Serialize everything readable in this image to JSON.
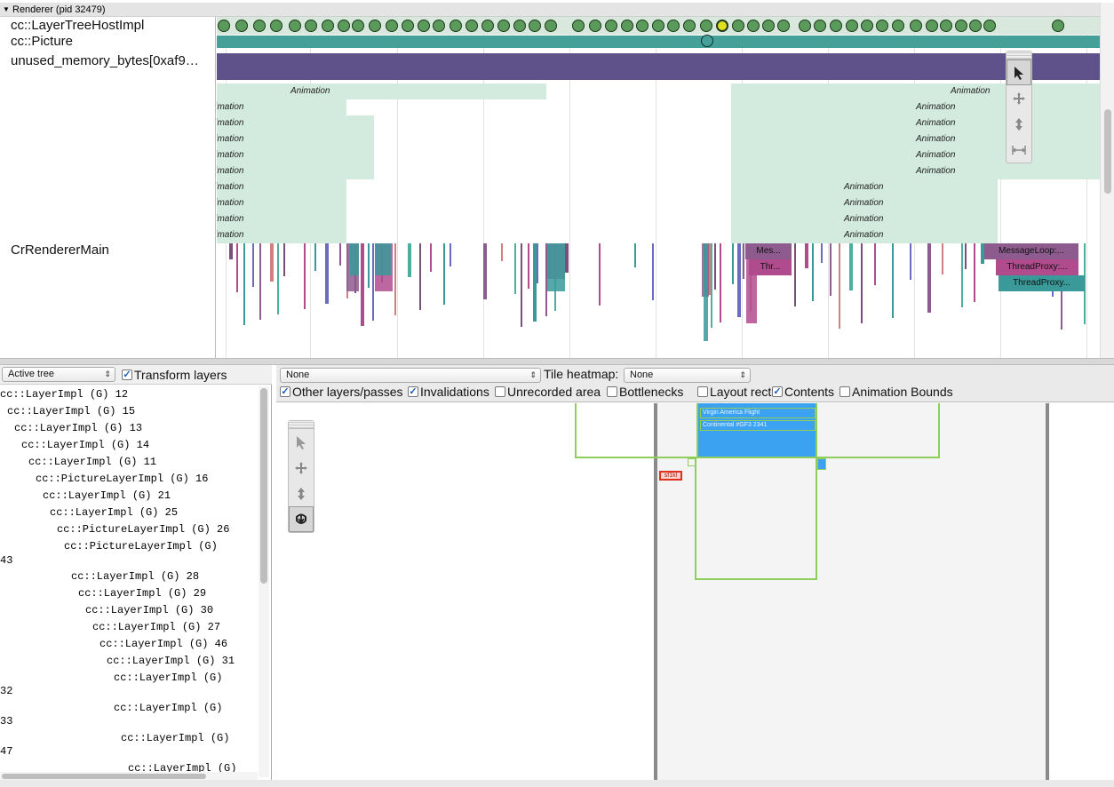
{
  "timeline": {
    "process_header": "Renderer (pid 32479)",
    "tracks": [
      {
        "label": "cc::LayerTreeHostImpl"
      },
      {
        "label": "cc::Picture"
      },
      {
        "label": "unused_memory_bytes[0xaf9…"
      },
      {
        "label": "CrRendererMain"
      }
    ],
    "animation_label": "Animation",
    "slices": {
      "mess": "Mes...",
      "thr": "Thr...",
      "message_loop": "MessageLoop:...",
      "thread_proxy_1": "ThreadProxy:...",
      "thread_proxy_2": "ThreadProxy..."
    },
    "colors": {
      "layer_row": "#d9e8dc",
      "dot_fill": "#5a9a5a",
      "selected_dot": "#e0e020",
      "picture_row": "#45a09a",
      "memory_row": "#5f528a",
      "animation": "#d3eadf"
    }
  },
  "mouse_tools": {
    "timeline_palette": [
      "selection-tool-icon",
      "pan-tool-icon",
      "zoom-tool-icon",
      "timing-tool-icon"
    ],
    "viewer_palette": [
      "selection-tool-icon",
      "pan-tool-icon",
      "zoom-tool-icon",
      "rotate-tool-icon"
    ]
  },
  "layer_panel": {
    "tree_select": "Active tree",
    "transform_layers_label": "Transform layers",
    "transform_layers_checked": true,
    "tree_items": [
      "cc::LayerImpl (G) 12",
      "cc::LayerImpl (G) 15",
      "cc::LayerImpl (G) 13",
      "cc::LayerImpl (G) 14",
      "cc::LayerImpl (G) 11",
      "cc::PictureLayerImpl (G) 16",
      "cc::LayerImpl (G) 21",
      "cc::LayerImpl (G) 25",
      "cc::PictureLayerImpl (G) 26",
      "cc::PictureLayerImpl (G)",
      "43",
      "cc::LayerImpl (G) 28",
      "cc::LayerImpl (G) 29",
      "cc::LayerImpl (G) 30",
      "cc::LayerImpl (G) 27",
      "cc::LayerImpl (G) 46",
      "cc::LayerImpl (G) 31",
      "cc::LayerImpl (G)",
      "32",
      "cc::LayerImpl (G)",
      "33",
      "cc::LayerImpl (G)",
      "47",
      "cc::LayerImpl (G)"
    ]
  },
  "viewer": {
    "layer_select": "None",
    "tile_heatmap_label": "Tile heatmap:",
    "tile_heatmap_select": "None",
    "options": [
      {
        "label": "Other layers/passes",
        "checked": true
      },
      {
        "label": "Invalidations",
        "checked": true
      },
      {
        "label": "Unrecorded area",
        "checked": false
      },
      {
        "label": "Bottlenecks",
        "checked": false
      },
      {
        "label": "Layout rects",
        "checked": false
      },
      {
        "label": "Contents",
        "checked": true
      },
      {
        "label": "Animation Bounds",
        "checked": false
      }
    ],
    "content_text_1": "Virgin America Flight",
    "content_text_2": "Continental #GF3 2341",
    "red_label": "sf1kl",
    "colors": {
      "blue_content": "#3ba2f2",
      "quad_border": "#8fce5a",
      "red_label": "#e03020"
    }
  }
}
